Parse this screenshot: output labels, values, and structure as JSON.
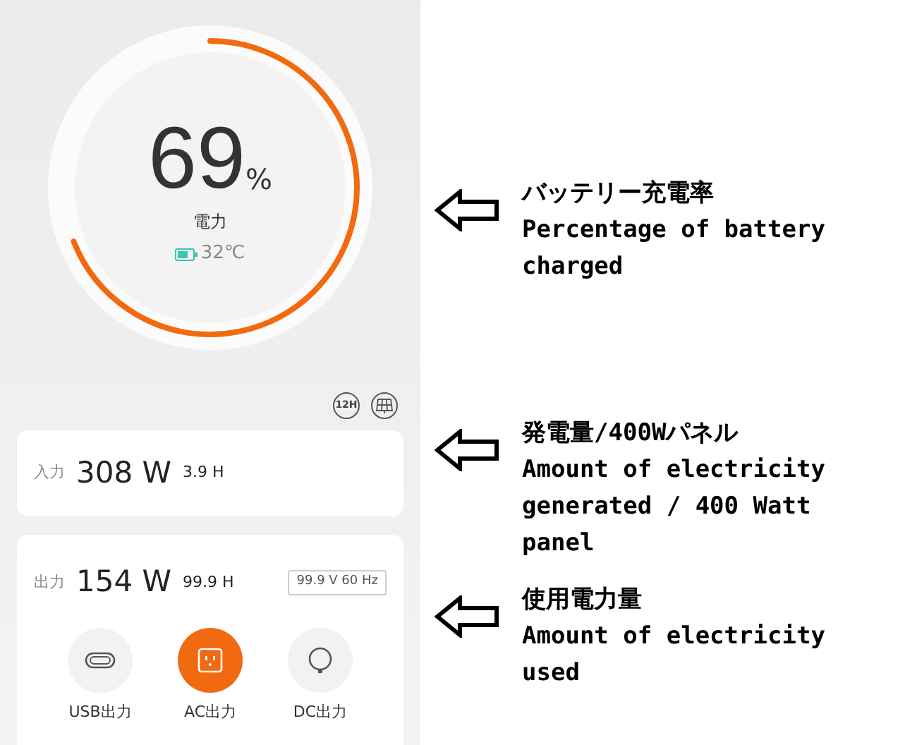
{
  "battery": {
    "level": 0.69,
    "value": "69",
    "unit": "%",
    "label": "電力",
    "temperature": "32℃"
  },
  "toolbar": {
    "timer_label": "12H"
  },
  "input": {
    "label": "入力",
    "power": "308 W",
    "time": "3.9 H"
  },
  "output": {
    "label": "出力",
    "power": "154 W",
    "time": "99.9 H",
    "spec": "99.9 V 60 Hz",
    "ports": [
      {
        "kind": "usb",
        "label": "USB出力",
        "selected": false
      },
      {
        "kind": "ac",
        "label": "AC出力",
        "selected": true
      },
      {
        "kind": "dc",
        "label": "DC出力",
        "selected": false
      }
    ]
  },
  "annotations": [
    {
      "title": "バッテリー充電率",
      "description": "Percentage of battery charged"
    },
    {
      "title": "発電量/400Wパネル",
      "description": "Amount of electricity generated / 400 Watt panel"
    },
    {
      "title": "使用電力量",
      "description": "Amount of electricity used"
    }
  ]
}
